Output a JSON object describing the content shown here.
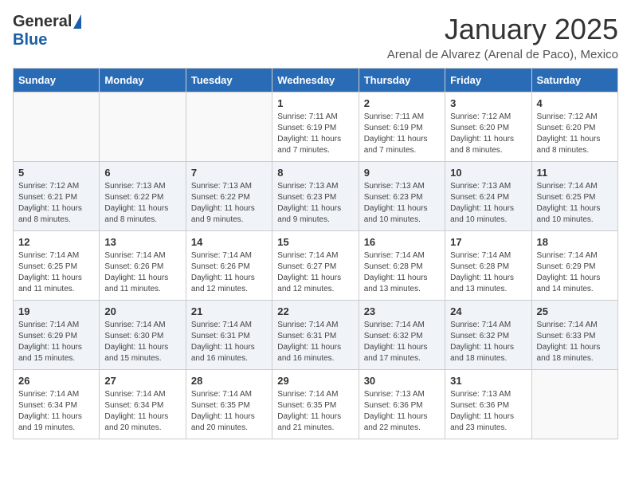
{
  "logo": {
    "general": "General",
    "blue": "Blue"
  },
  "title": "January 2025",
  "location": "Arenal de Alvarez (Arenal de Paco), Mexico",
  "days_of_week": [
    "Sunday",
    "Monday",
    "Tuesday",
    "Wednesday",
    "Thursday",
    "Friday",
    "Saturday"
  ],
  "weeks": [
    [
      {
        "day": "",
        "sunrise": "",
        "sunset": "",
        "daylight": ""
      },
      {
        "day": "",
        "sunrise": "",
        "sunset": "",
        "daylight": ""
      },
      {
        "day": "",
        "sunrise": "",
        "sunset": "",
        "daylight": ""
      },
      {
        "day": "1",
        "sunrise": "Sunrise: 7:11 AM",
        "sunset": "Sunset: 6:19 PM",
        "daylight": "Daylight: 11 hours and 7 minutes."
      },
      {
        "day": "2",
        "sunrise": "Sunrise: 7:11 AM",
        "sunset": "Sunset: 6:19 PM",
        "daylight": "Daylight: 11 hours and 7 minutes."
      },
      {
        "day": "3",
        "sunrise": "Sunrise: 7:12 AM",
        "sunset": "Sunset: 6:20 PM",
        "daylight": "Daylight: 11 hours and 8 minutes."
      },
      {
        "day": "4",
        "sunrise": "Sunrise: 7:12 AM",
        "sunset": "Sunset: 6:20 PM",
        "daylight": "Daylight: 11 hours and 8 minutes."
      }
    ],
    [
      {
        "day": "5",
        "sunrise": "Sunrise: 7:12 AM",
        "sunset": "Sunset: 6:21 PM",
        "daylight": "Daylight: 11 hours and 8 minutes."
      },
      {
        "day": "6",
        "sunrise": "Sunrise: 7:13 AM",
        "sunset": "Sunset: 6:22 PM",
        "daylight": "Daylight: 11 hours and 8 minutes."
      },
      {
        "day": "7",
        "sunrise": "Sunrise: 7:13 AM",
        "sunset": "Sunset: 6:22 PM",
        "daylight": "Daylight: 11 hours and 9 minutes."
      },
      {
        "day": "8",
        "sunrise": "Sunrise: 7:13 AM",
        "sunset": "Sunset: 6:23 PM",
        "daylight": "Daylight: 11 hours and 9 minutes."
      },
      {
        "day": "9",
        "sunrise": "Sunrise: 7:13 AM",
        "sunset": "Sunset: 6:23 PM",
        "daylight": "Daylight: 11 hours and 10 minutes."
      },
      {
        "day": "10",
        "sunrise": "Sunrise: 7:13 AM",
        "sunset": "Sunset: 6:24 PM",
        "daylight": "Daylight: 11 hours and 10 minutes."
      },
      {
        "day": "11",
        "sunrise": "Sunrise: 7:14 AM",
        "sunset": "Sunset: 6:25 PM",
        "daylight": "Daylight: 11 hours and 10 minutes."
      }
    ],
    [
      {
        "day": "12",
        "sunrise": "Sunrise: 7:14 AM",
        "sunset": "Sunset: 6:25 PM",
        "daylight": "Daylight: 11 hours and 11 minutes."
      },
      {
        "day": "13",
        "sunrise": "Sunrise: 7:14 AM",
        "sunset": "Sunset: 6:26 PM",
        "daylight": "Daylight: 11 hours and 11 minutes."
      },
      {
        "day": "14",
        "sunrise": "Sunrise: 7:14 AM",
        "sunset": "Sunset: 6:26 PM",
        "daylight": "Daylight: 11 hours and 12 minutes."
      },
      {
        "day": "15",
        "sunrise": "Sunrise: 7:14 AM",
        "sunset": "Sunset: 6:27 PM",
        "daylight": "Daylight: 11 hours and 12 minutes."
      },
      {
        "day": "16",
        "sunrise": "Sunrise: 7:14 AM",
        "sunset": "Sunset: 6:28 PM",
        "daylight": "Daylight: 11 hours and 13 minutes."
      },
      {
        "day": "17",
        "sunrise": "Sunrise: 7:14 AM",
        "sunset": "Sunset: 6:28 PM",
        "daylight": "Daylight: 11 hours and 13 minutes."
      },
      {
        "day": "18",
        "sunrise": "Sunrise: 7:14 AM",
        "sunset": "Sunset: 6:29 PM",
        "daylight": "Daylight: 11 hours and 14 minutes."
      }
    ],
    [
      {
        "day": "19",
        "sunrise": "Sunrise: 7:14 AM",
        "sunset": "Sunset: 6:29 PM",
        "daylight": "Daylight: 11 hours and 15 minutes."
      },
      {
        "day": "20",
        "sunrise": "Sunrise: 7:14 AM",
        "sunset": "Sunset: 6:30 PM",
        "daylight": "Daylight: 11 hours and 15 minutes."
      },
      {
        "day": "21",
        "sunrise": "Sunrise: 7:14 AM",
        "sunset": "Sunset: 6:31 PM",
        "daylight": "Daylight: 11 hours and 16 minutes."
      },
      {
        "day": "22",
        "sunrise": "Sunrise: 7:14 AM",
        "sunset": "Sunset: 6:31 PM",
        "daylight": "Daylight: 11 hours and 16 minutes."
      },
      {
        "day": "23",
        "sunrise": "Sunrise: 7:14 AM",
        "sunset": "Sunset: 6:32 PM",
        "daylight": "Daylight: 11 hours and 17 minutes."
      },
      {
        "day": "24",
        "sunrise": "Sunrise: 7:14 AM",
        "sunset": "Sunset: 6:32 PM",
        "daylight": "Daylight: 11 hours and 18 minutes."
      },
      {
        "day": "25",
        "sunrise": "Sunrise: 7:14 AM",
        "sunset": "Sunset: 6:33 PM",
        "daylight": "Daylight: 11 hours and 18 minutes."
      }
    ],
    [
      {
        "day": "26",
        "sunrise": "Sunrise: 7:14 AM",
        "sunset": "Sunset: 6:34 PM",
        "daylight": "Daylight: 11 hours and 19 minutes."
      },
      {
        "day": "27",
        "sunrise": "Sunrise: 7:14 AM",
        "sunset": "Sunset: 6:34 PM",
        "daylight": "Daylight: 11 hours and 20 minutes."
      },
      {
        "day": "28",
        "sunrise": "Sunrise: 7:14 AM",
        "sunset": "Sunset: 6:35 PM",
        "daylight": "Daylight: 11 hours and 20 minutes."
      },
      {
        "day": "29",
        "sunrise": "Sunrise: 7:14 AM",
        "sunset": "Sunset: 6:35 PM",
        "daylight": "Daylight: 11 hours and 21 minutes."
      },
      {
        "day": "30",
        "sunrise": "Sunrise: 7:13 AM",
        "sunset": "Sunset: 6:36 PM",
        "daylight": "Daylight: 11 hours and 22 minutes."
      },
      {
        "day": "31",
        "sunrise": "Sunrise: 7:13 AM",
        "sunset": "Sunset: 6:36 PM",
        "daylight": "Daylight: 11 hours and 23 minutes."
      },
      {
        "day": "",
        "sunrise": "",
        "sunset": "",
        "daylight": ""
      }
    ]
  ]
}
